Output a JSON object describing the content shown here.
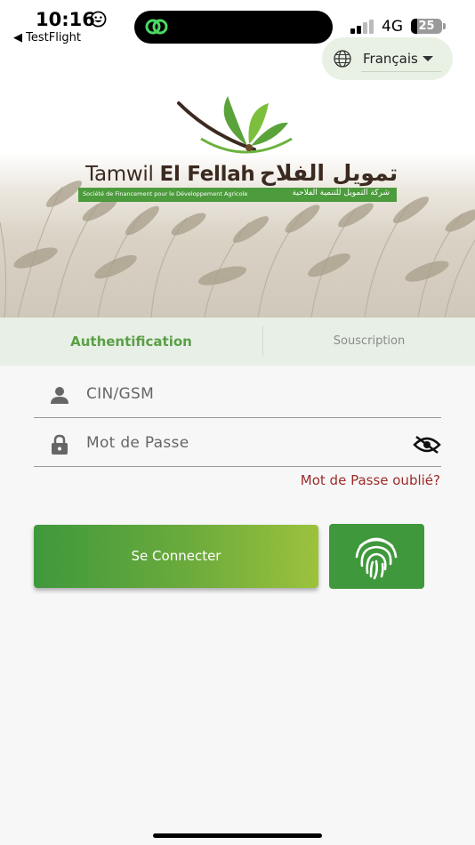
{
  "status_bar": {
    "time": "10:16",
    "back_label": "◀ TestFlight",
    "network": "4G",
    "battery": "25"
  },
  "language": {
    "label": "Français",
    "icon": "globe-icon"
  },
  "brand": {
    "name_regular": "Tamwil ",
    "name_bold": "El Fellah",
    "name_arabic": "تمويل الفلاح",
    "tagline_fr": "Société de Financement pour le Développement Agricole",
    "tagline_ar": "شركة التمويل للتنمية الفلاحية"
  },
  "tabs": {
    "auth": "Authentification",
    "subscribe": "Souscription"
  },
  "form": {
    "id_placeholder": "CIN/GSM",
    "password_placeholder": "Mot de Passe",
    "forgot": "Mot de Passe oublié?",
    "connect": "Se Connecter"
  },
  "colors": {
    "primary_green": "#3f983c",
    "tab_active": "#5aa046",
    "forgot_red": "#9c2a2a"
  }
}
